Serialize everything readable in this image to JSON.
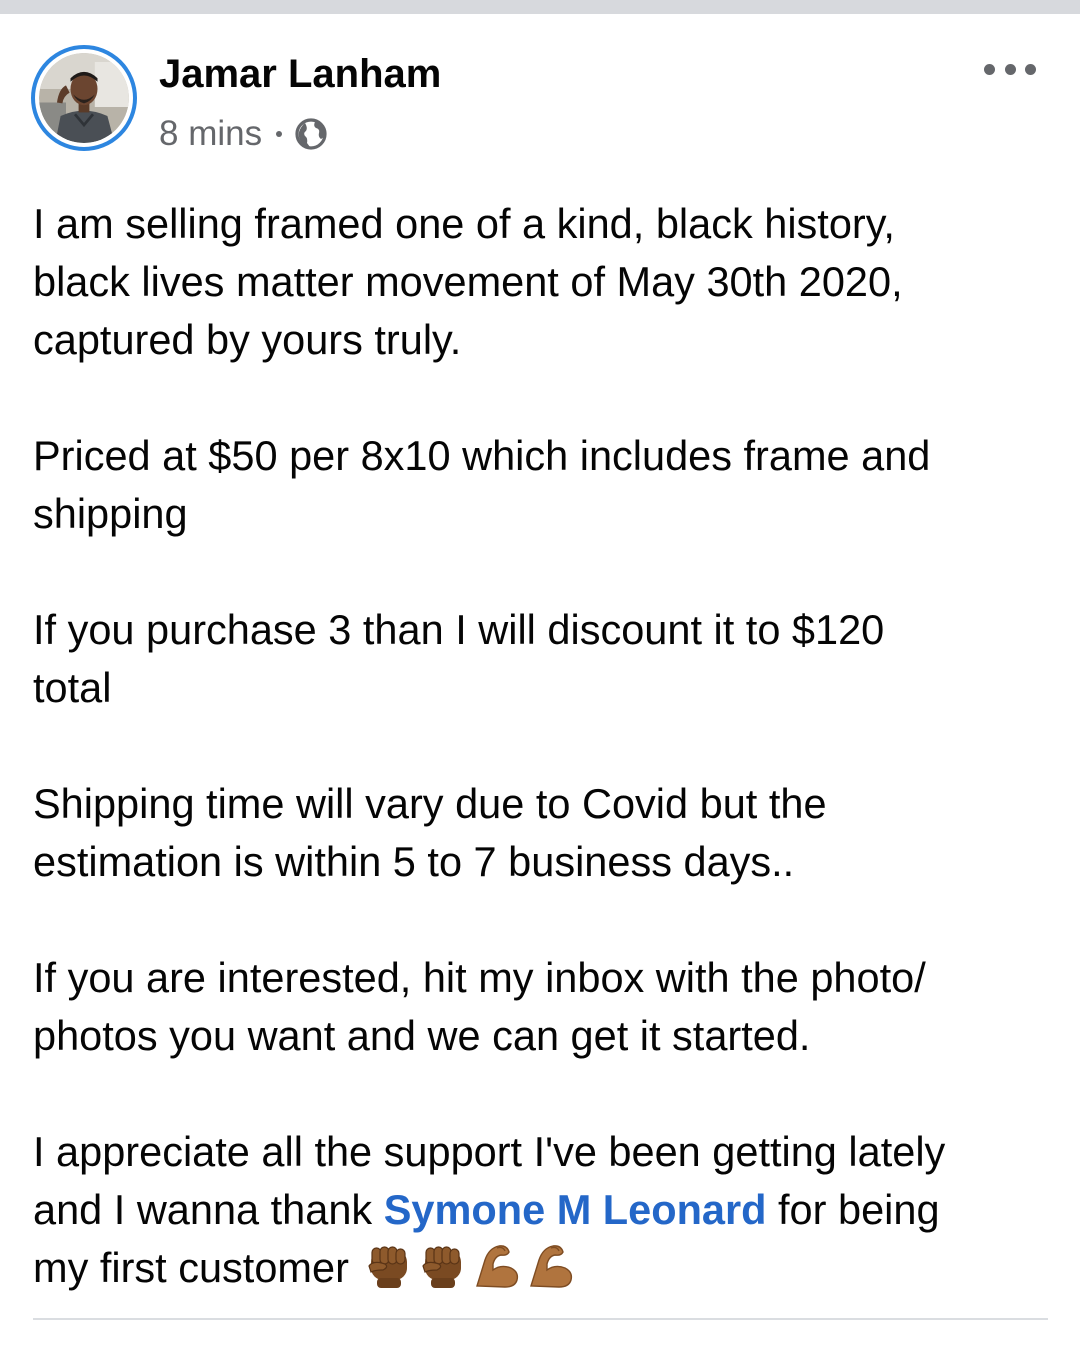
{
  "post": {
    "author": {
      "name": "Jamar Lanham",
      "avatar_icon": "profile-photo"
    },
    "timestamp": "8 mins",
    "audience_icon": "globe-icon",
    "more_icon": "more-options-icon",
    "body": {
      "p1_line1": "I am selling framed one of a kind, black history,",
      "p1_line2": "black lives matter movement of May 30th 2020,",
      "p1_line3": "captured by yours truly.",
      "p2_line1": "Priced at $50 per 8x10 which includes frame and",
      "p2_line2": "shipping",
      "p3_line1": "If you purchase 3 than I will discount it to $120",
      "p3_line2": "total",
      "p4_line1": "Shipping time will vary due to Covid but the",
      "p4_line2": "estimation is within 5 to 7 business days..",
      "p5_line1": "If you are interested, hit my inbox with the photo/",
      "p5_line2": "photos you want and we can get it started.",
      "p6_line1": "I appreciate all the support I've been getting lately",
      "p6_line2_before": "and I wanna thank ",
      "mention": "Symone M Leonard",
      "p6_line2_after": " for being",
      "p6_line3": "my first customer"
    },
    "emojis": [
      "raised-fist-medium-dark",
      "raised-fist-medium-dark",
      "flexed-biceps-medium",
      "flexed-biceps-medium"
    ],
    "colors": {
      "link": "#2467c8",
      "avatar_ring": "#2d86e0",
      "meta_text": "#65676b",
      "top_strip": "#d7d9dd"
    }
  }
}
